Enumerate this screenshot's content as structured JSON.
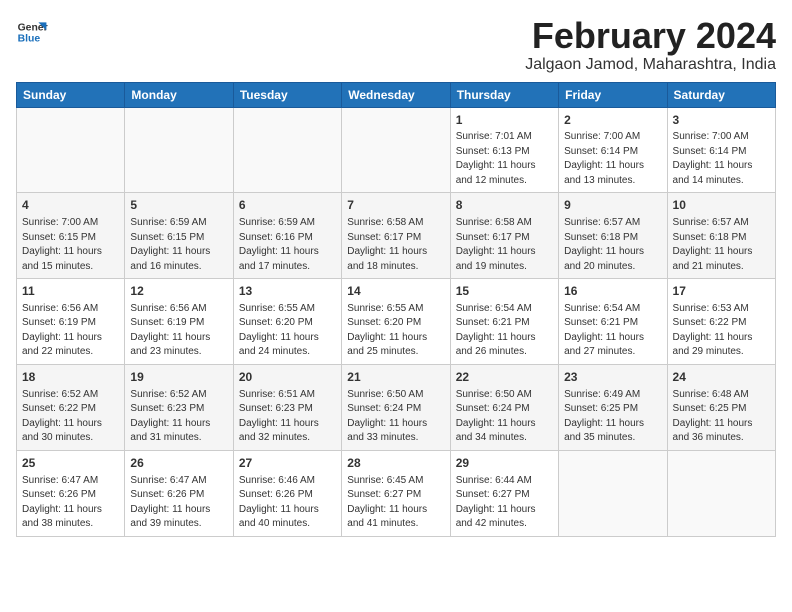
{
  "logo": {
    "general": "General",
    "blue": "Blue"
  },
  "header": {
    "title": "February 2024",
    "subtitle": "Jalgaon Jamod, Maharashtra, India"
  },
  "weekdays": [
    "Sunday",
    "Monday",
    "Tuesday",
    "Wednesday",
    "Thursday",
    "Friday",
    "Saturday"
  ],
  "weeks": [
    [
      {
        "day": "",
        "info": ""
      },
      {
        "day": "",
        "info": ""
      },
      {
        "day": "",
        "info": ""
      },
      {
        "day": "",
        "info": ""
      },
      {
        "day": "1",
        "info": "Sunrise: 7:01 AM\nSunset: 6:13 PM\nDaylight: 11 hours\nand 12 minutes."
      },
      {
        "day": "2",
        "info": "Sunrise: 7:00 AM\nSunset: 6:14 PM\nDaylight: 11 hours\nand 13 minutes."
      },
      {
        "day": "3",
        "info": "Sunrise: 7:00 AM\nSunset: 6:14 PM\nDaylight: 11 hours\nand 14 minutes."
      }
    ],
    [
      {
        "day": "4",
        "info": "Sunrise: 7:00 AM\nSunset: 6:15 PM\nDaylight: 11 hours\nand 15 minutes."
      },
      {
        "day": "5",
        "info": "Sunrise: 6:59 AM\nSunset: 6:15 PM\nDaylight: 11 hours\nand 16 minutes."
      },
      {
        "day": "6",
        "info": "Sunrise: 6:59 AM\nSunset: 6:16 PM\nDaylight: 11 hours\nand 17 minutes."
      },
      {
        "day": "7",
        "info": "Sunrise: 6:58 AM\nSunset: 6:17 PM\nDaylight: 11 hours\nand 18 minutes."
      },
      {
        "day": "8",
        "info": "Sunrise: 6:58 AM\nSunset: 6:17 PM\nDaylight: 11 hours\nand 19 minutes."
      },
      {
        "day": "9",
        "info": "Sunrise: 6:57 AM\nSunset: 6:18 PM\nDaylight: 11 hours\nand 20 minutes."
      },
      {
        "day": "10",
        "info": "Sunrise: 6:57 AM\nSunset: 6:18 PM\nDaylight: 11 hours\nand 21 minutes."
      }
    ],
    [
      {
        "day": "11",
        "info": "Sunrise: 6:56 AM\nSunset: 6:19 PM\nDaylight: 11 hours\nand 22 minutes."
      },
      {
        "day": "12",
        "info": "Sunrise: 6:56 AM\nSunset: 6:19 PM\nDaylight: 11 hours\nand 23 minutes."
      },
      {
        "day": "13",
        "info": "Sunrise: 6:55 AM\nSunset: 6:20 PM\nDaylight: 11 hours\nand 24 minutes."
      },
      {
        "day": "14",
        "info": "Sunrise: 6:55 AM\nSunset: 6:20 PM\nDaylight: 11 hours\nand 25 minutes."
      },
      {
        "day": "15",
        "info": "Sunrise: 6:54 AM\nSunset: 6:21 PM\nDaylight: 11 hours\nand 26 minutes."
      },
      {
        "day": "16",
        "info": "Sunrise: 6:54 AM\nSunset: 6:21 PM\nDaylight: 11 hours\nand 27 minutes."
      },
      {
        "day": "17",
        "info": "Sunrise: 6:53 AM\nSunset: 6:22 PM\nDaylight: 11 hours\nand 29 minutes."
      }
    ],
    [
      {
        "day": "18",
        "info": "Sunrise: 6:52 AM\nSunset: 6:22 PM\nDaylight: 11 hours\nand 30 minutes."
      },
      {
        "day": "19",
        "info": "Sunrise: 6:52 AM\nSunset: 6:23 PM\nDaylight: 11 hours\nand 31 minutes."
      },
      {
        "day": "20",
        "info": "Sunrise: 6:51 AM\nSunset: 6:23 PM\nDaylight: 11 hours\nand 32 minutes."
      },
      {
        "day": "21",
        "info": "Sunrise: 6:50 AM\nSunset: 6:24 PM\nDaylight: 11 hours\nand 33 minutes."
      },
      {
        "day": "22",
        "info": "Sunrise: 6:50 AM\nSunset: 6:24 PM\nDaylight: 11 hours\nand 34 minutes."
      },
      {
        "day": "23",
        "info": "Sunrise: 6:49 AM\nSunset: 6:25 PM\nDaylight: 11 hours\nand 35 minutes."
      },
      {
        "day": "24",
        "info": "Sunrise: 6:48 AM\nSunset: 6:25 PM\nDaylight: 11 hours\nand 36 minutes."
      }
    ],
    [
      {
        "day": "25",
        "info": "Sunrise: 6:47 AM\nSunset: 6:26 PM\nDaylight: 11 hours\nand 38 minutes."
      },
      {
        "day": "26",
        "info": "Sunrise: 6:47 AM\nSunset: 6:26 PM\nDaylight: 11 hours\nand 39 minutes."
      },
      {
        "day": "27",
        "info": "Sunrise: 6:46 AM\nSunset: 6:26 PM\nDaylight: 11 hours\nand 40 minutes."
      },
      {
        "day": "28",
        "info": "Sunrise: 6:45 AM\nSunset: 6:27 PM\nDaylight: 11 hours\nand 41 minutes."
      },
      {
        "day": "29",
        "info": "Sunrise: 6:44 AM\nSunset: 6:27 PM\nDaylight: 11 hours\nand 42 minutes."
      },
      {
        "day": "",
        "info": ""
      },
      {
        "day": "",
        "info": ""
      }
    ]
  ]
}
